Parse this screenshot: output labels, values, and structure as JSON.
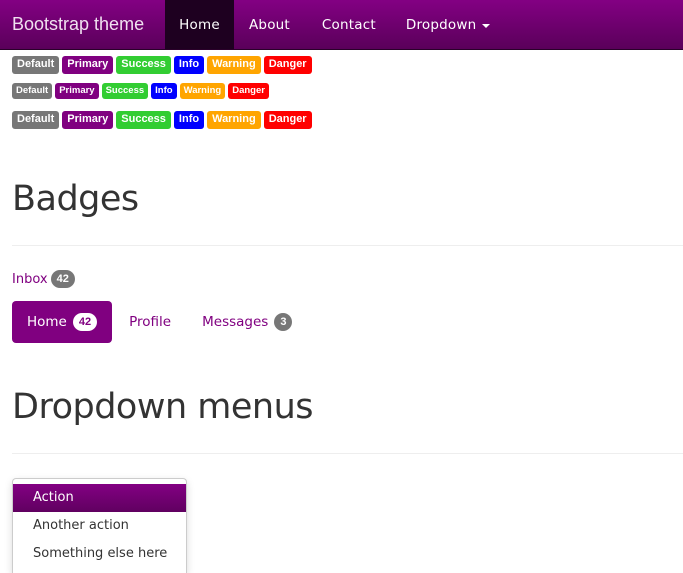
{
  "navbar": {
    "brand": "Bootstrap theme",
    "items": [
      {
        "label": "Home",
        "active": true
      },
      {
        "label": "About"
      },
      {
        "label": "Contact"
      },
      {
        "label": "Dropdown",
        "has_caret": true
      }
    ]
  },
  "labels": {
    "default": "Default",
    "primary": "Primary",
    "success": "Success",
    "info": "Info",
    "warning": "Warning",
    "danger": "Danger"
  },
  "colors": {
    "default": "#777777",
    "primary": "#800080",
    "success": "#32cd32",
    "info": "#0000ff",
    "warning": "#ffa500",
    "danger": "#ff0000"
  },
  "badges_section": {
    "title": "Badges",
    "inbox": {
      "label": "Inbox",
      "count": "42"
    },
    "pills": [
      {
        "label": "Home",
        "count": "42",
        "active": true
      },
      {
        "label": "Profile"
      },
      {
        "label": "Messages",
        "count": "3"
      }
    ]
  },
  "dropdown_section": {
    "title": "Dropdown menus",
    "items": [
      {
        "label": "Action",
        "active": true
      },
      {
        "label": "Another action"
      },
      {
        "label": "Something else here"
      }
    ]
  }
}
